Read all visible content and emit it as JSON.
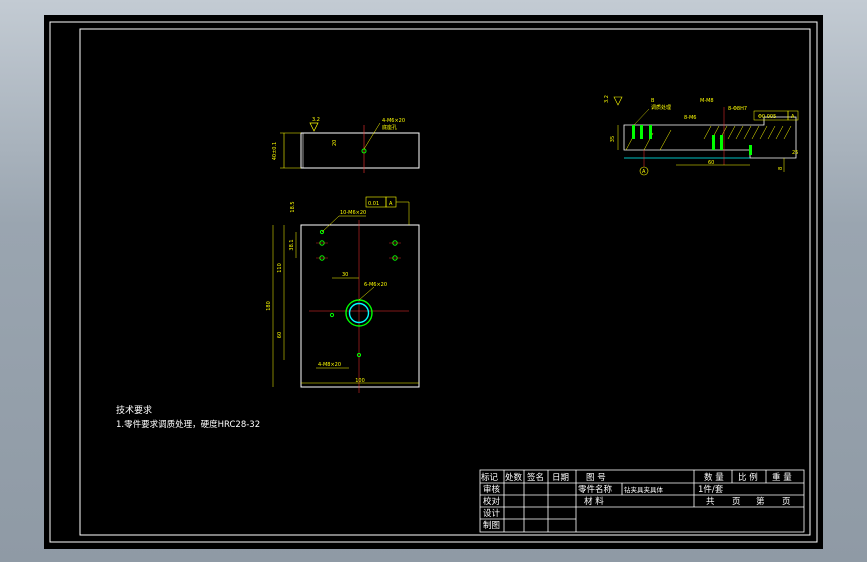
{
  "colors": {
    "background": "#000000",
    "border": "#ffffff",
    "part_outline": "#ffffff",
    "center_line": "#ff3333",
    "dimension": "#ffff00",
    "hole": "#00ff00",
    "section_line": "#00ffff",
    "hatch": "#ffff00"
  },
  "technical_requirements": {
    "title": "技术要求",
    "item_1": "1.零件要求调质处理，硬度HRC28-32"
  },
  "title_block": {
    "col_biaoji": "标记",
    "col_chushu": "处数",
    "col_qianming": "签名",
    "col_riqi": "日期",
    "tuhao": "图  号",
    "shuliang": "数 量",
    "bili": "比 例",
    "zhongliang": "重 量",
    "shenhe": "审核",
    "lingjian_mingcheng": "零件名称",
    "part_name": "钻夹具夹具体",
    "quantity": "1件/套",
    "jiaozhen": "校对",
    "cailiao": "材  料",
    "gong": "共",
    "ye1": "页",
    "di": "第",
    "ye2": "页",
    "sheji": "设计",
    "zhitu": "制图"
  },
  "dimensions": {
    "top_view": {
      "thickness": "40±0.1",
      "surface_finish": "3.2",
      "hole_note": "4-M6×20",
      "hole_note_2": "底座孔",
      "hole_depth": "20"
    },
    "front_view": {
      "top_offset": "18.5",
      "tolerance_value": "0.01",
      "tolerance_datum": "A",
      "hole_spec": "10-M6×20",
      "spacing": "38.1",
      "overall_height": "180",
      "upper_height": "110",
      "lower_height": "60",
      "bore_offset": "30",
      "bore_spec": "6-M6×20",
      "bottom_spec": "4-M8×20",
      "width": "100"
    },
    "section_view": {
      "surface_finish": "3.2",
      "note_1": "B",
      "note_2": "调质处理",
      "spec_1": "M-M8",
      "spec_2": "8-Φ8H7",
      "spec_3": "8-M6",
      "spec_4": "Φ0.005",
      "spec_4_datum": "A",
      "height": "35",
      "length": "60",
      "right_dim": "8",
      "right_dim_2": "25",
      "datum": "A"
    }
  }
}
